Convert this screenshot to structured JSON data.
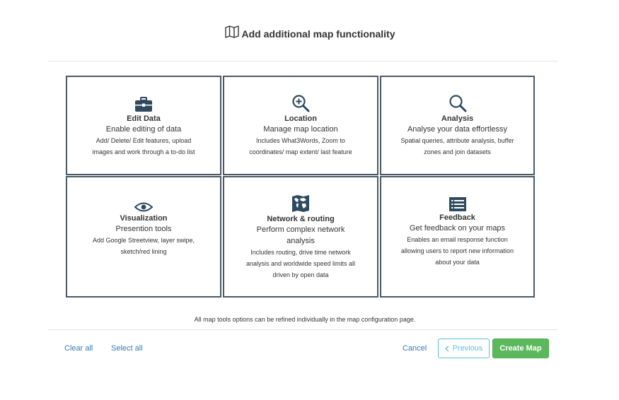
{
  "header": {
    "title": "Add additional map functionality",
    "icon": "map-icon"
  },
  "cards": [
    {
      "icon": "briefcase-icon",
      "title": "Edit Data",
      "subtitle": "Enable editing of data",
      "desc": [
        "Add/ Delete/ Edit features, upload",
        "images and work through a to-do list"
      ]
    },
    {
      "icon": "zoom-in-icon",
      "title": "Location",
      "subtitle": "Manage map location",
      "desc": [
        "Includes What3Words, Zoom to",
        "coordinates/ map extent/ last feature"
      ]
    },
    {
      "icon": "magnifier-icon",
      "title": "Analysis",
      "subtitle": "Analyse your data effortlessy",
      "desc": [
        "Spatial queries, attribute analysis, buffer",
        "zones and join datasets"
      ]
    },
    {
      "icon": "eye-icon",
      "title": "Visualization",
      "subtitle": "Presention tools",
      "desc": [
        "Add Google Streetview, layer swipe,",
        "sketch/red lining"
      ]
    },
    {
      "icon": "world-map-icon",
      "title": "Network & routing",
      "subtitle": [
        "Perform complex network",
        "analysis"
      ],
      "desc": [
        "Includes routing, drive time network",
        "analysis and worldwide speed limits all",
        "driven by open data"
      ]
    },
    {
      "icon": "list-icon",
      "title": "Feedback",
      "subtitle": "Get feedback on your maps",
      "desc": [
        "Enables an email response function",
        "allowing users to report new information",
        "about your data"
      ]
    }
  ],
  "note": "All map tools options can be refined individually in the map configuration page.",
  "footer": {
    "clear_all": "Clear all",
    "select_all": "Select all",
    "cancel": "Cancel",
    "previous": "Previous",
    "previous_icon": "chevron-left-icon",
    "create_map": "Create Map"
  },
  "colors": {
    "card_border": "#4b5a66",
    "icon": "#2e4a5e",
    "link": "#337ab7",
    "info": "#5bc0de",
    "success": "#5cb85c"
  }
}
